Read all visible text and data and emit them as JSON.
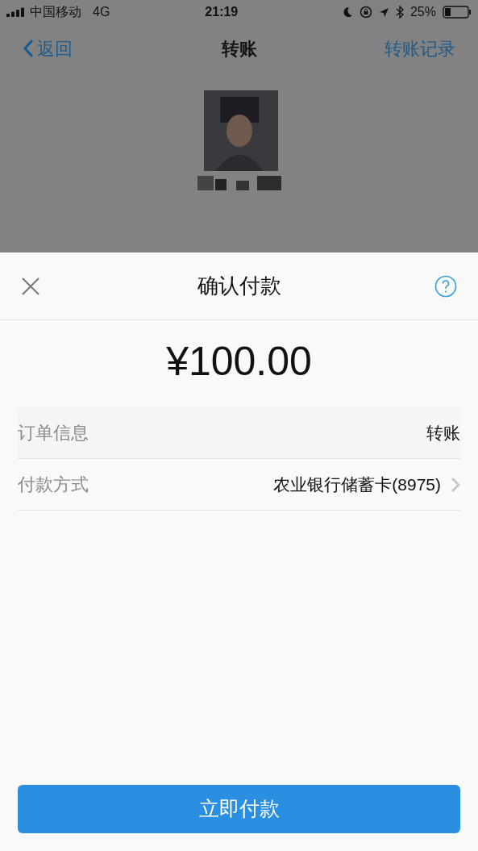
{
  "status_bar": {
    "carrier": "中国移动",
    "network": "4G",
    "time": "21:19",
    "battery": "25%"
  },
  "nav": {
    "back": "返回",
    "title": "转账",
    "action": "转账记录"
  },
  "sheet": {
    "title": "确认付款",
    "amount": "¥100.00",
    "rows": [
      {
        "kind": "info",
        "label": "订单信息",
        "value": "转账"
      },
      {
        "kind": "link",
        "label": "付款方式",
        "value": "农业银行储蓄卡(8975)"
      }
    ],
    "button": "立即付款"
  }
}
